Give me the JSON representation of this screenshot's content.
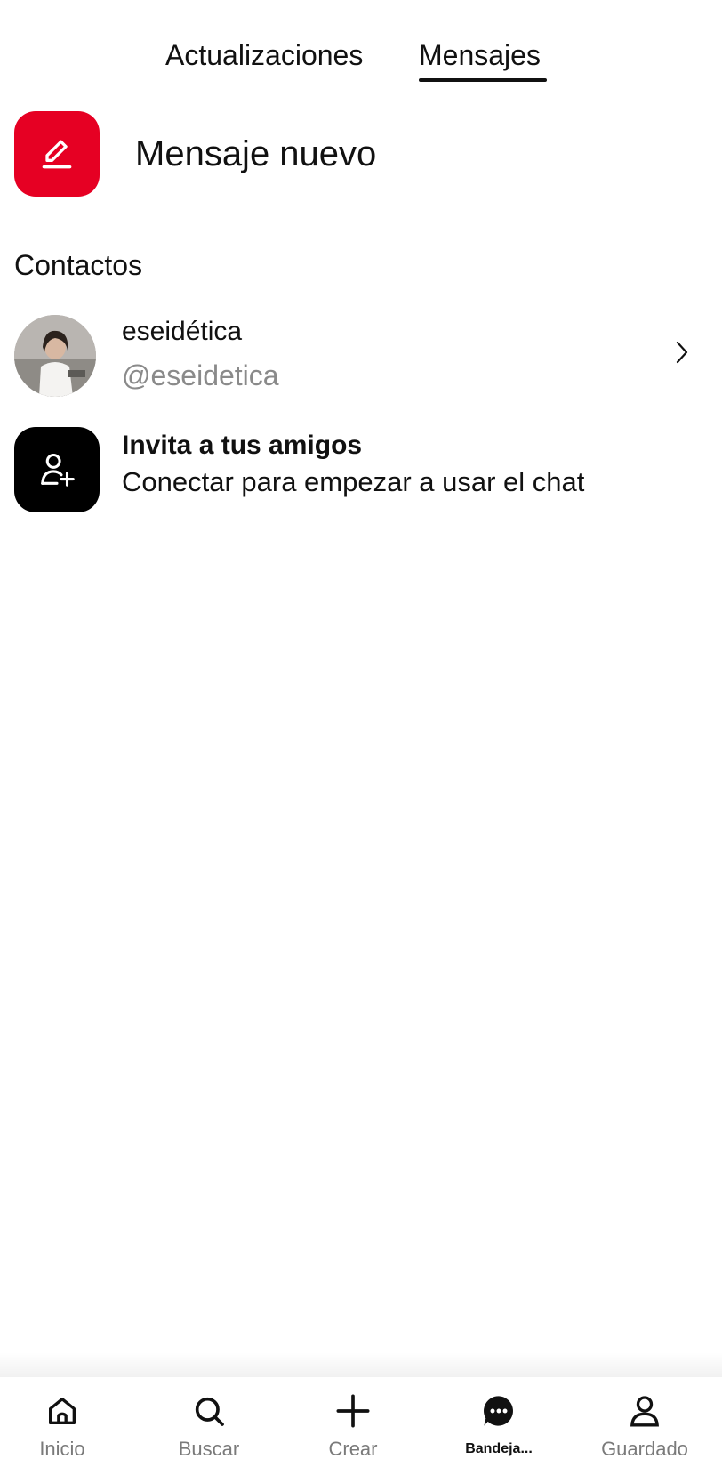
{
  "tabs": [
    {
      "label": "Actualizaciones",
      "active": false
    },
    {
      "label": "Mensajes",
      "active": true
    }
  ],
  "new_message": {
    "label": "Mensaje nuevo",
    "icon": "pencil-icon",
    "color": "#e60023"
  },
  "contacts_section": {
    "title": "Contactos"
  },
  "contact": {
    "name": "eseidética",
    "handle": "@eseidetica"
  },
  "invite": {
    "title": "Invita a tus amigos",
    "subtitle": "Conectar para empezar a usar el chat"
  },
  "bottom_nav": [
    {
      "label": "Inicio",
      "icon": "home-icon",
      "active": false
    },
    {
      "label": "Buscar",
      "icon": "search-icon",
      "active": false
    },
    {
      "label": "Crear",
      "icon": "plus-icon",
      "active": false
    },
    {
      "label": "Bandeja...",
      "icon": "chat-bubble-icon",
      "active": true
    },
    {
      "label": "Guardado",
      "icon": "profile-icon",
      "active": false
    }
  ]
}
